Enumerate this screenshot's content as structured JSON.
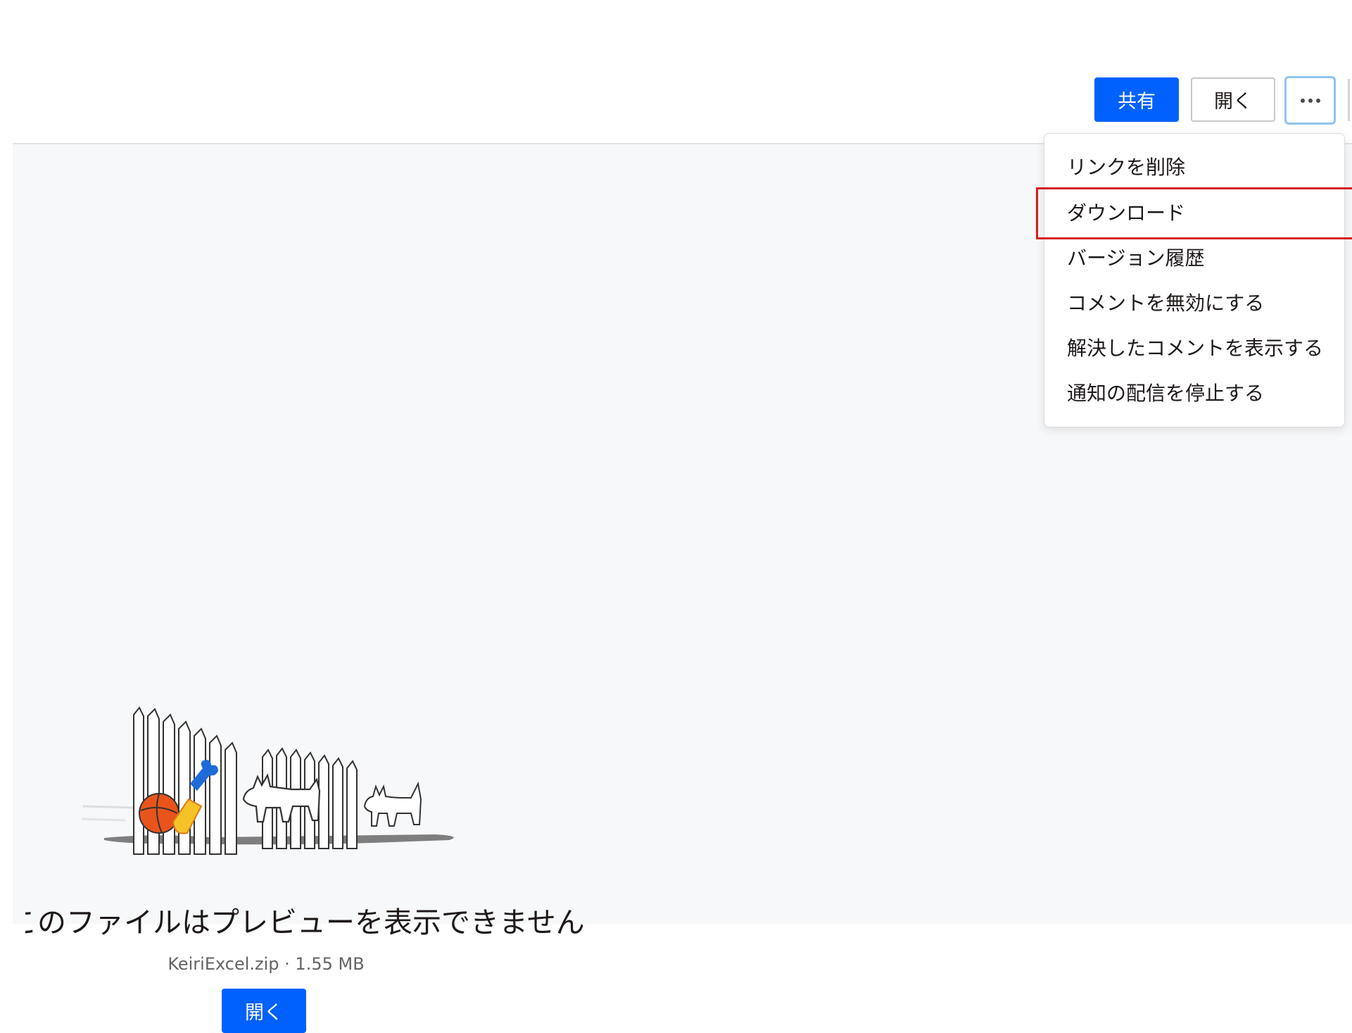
{
  "header": {
    "share_label": "共有",
    "open_label": "開く",
    "more_icon": "more-horizontal-icon"
  },
  "menu": {
    "items": [
      "リンクを削除",
      "ダウンロード",
      "バージョン履歴",
      "コメントを無効にする",
      "解決したコメントを表示する",
      "通知の配信を停止する"
    ],
    "highlighted_item": "ダウンロード",
    "highlight_color": "#d32020"
  },
  "preview": {
    "message": "このファイルはプレビューを表示できません",
    "file_meta": "KeiriExcel.zip · 1.55 MB",
    "open_label": "開く",
    "illustration": "dogs-fence-illustration"
  },
  "colors": {
    "primary": "#0061fe",
    "background": "#f7f8fa"
  }
}
